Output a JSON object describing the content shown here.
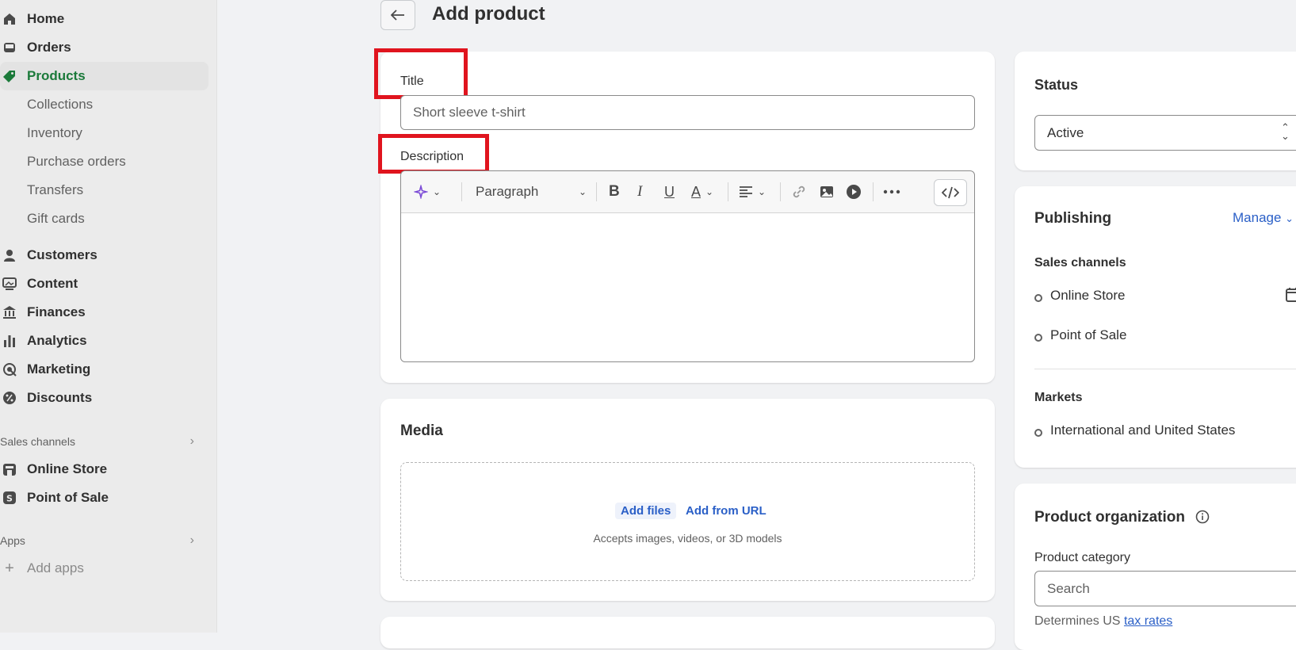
{
  "sidebar": {
    "items": [
      {
        "label": "Home",
        "icon": "home-icon"
      },
      {
        "label": "Orders",
        "icon": "inbox-icon"
      },
      {
        "label": "Products",
        "icon": "tag-icon"
      },
      {
        "label": "Collections"
      },
      {
        "label": "Inventory"
      },
      {
        "label": "Purchase orders"
      },
      {
        "label": "Transfers"
      },
      {
        "label": "Gift cards"
      },
      {
        "label": "Customers",
        "icon": "person-icon"
      },
      {
        "label": "Content",
        "icon": "image-icon"
      },
      {
        "label": "Finances",
        "icon": "bank-icon"
      },
      {
        "label": "Analytics",
        "icon": "bar-chart-icon"
      },
      {
        "label": "Marketing",
        "icon": "target-icon"
      },
      {
        "label": "Discounts",
        "icon": "discount-icon"
      }
    ],
    "sales_channels_label": "Sales channels",
    "channels": [
      {
        "label": "Online Store",
        "icon": "store-icon"
      },
      {
        "label": "Point of Sale",
        "icon": "pos-icon"
      }
    ],
    "apps_label": "Apps",
    "add_apps_label": "Add apps"
  },
  "header": {
    "title": "Add product"
  },
  "product_form": {
    "title_label": "Title",
    "title_placeholder": "Short sleeve t-shirt",
    "description_label": "Description",
    "toolbar": {
      "paragraph_label": "Paragraph"
    }
  },
  "media": {
    "title": "Media",
    "add_files": "Add files",
    "add_from_url": "Add from URL",
    "hint": "Accepts images, videos, or 3D models"
  },
  "status": {
    "title": "Status",
    "value": "Active"
  },
  "publishing": {
    "title": "Publishing",
    "manage": "Manage",
    "sales_channels_title": "Sales channels",
    "channels": [
      "Online Store",
      "Point of Sale"
    ],
    "markets_title": "Markets",
    "markets": [
      "International and United States"
    ]
  },
  "organization": {
    "title": "Product organization",
    "category_label": "Product category",
    "category_placeholder": "Search",
    "tax_hint": "Determines US",
    "tax_link": "tax rates"
  },
  "colors": {
    "accent": "#1b7a3a",
    "link": "#2a5fc7",
    "highlight": "#e0141e"
  }
}
